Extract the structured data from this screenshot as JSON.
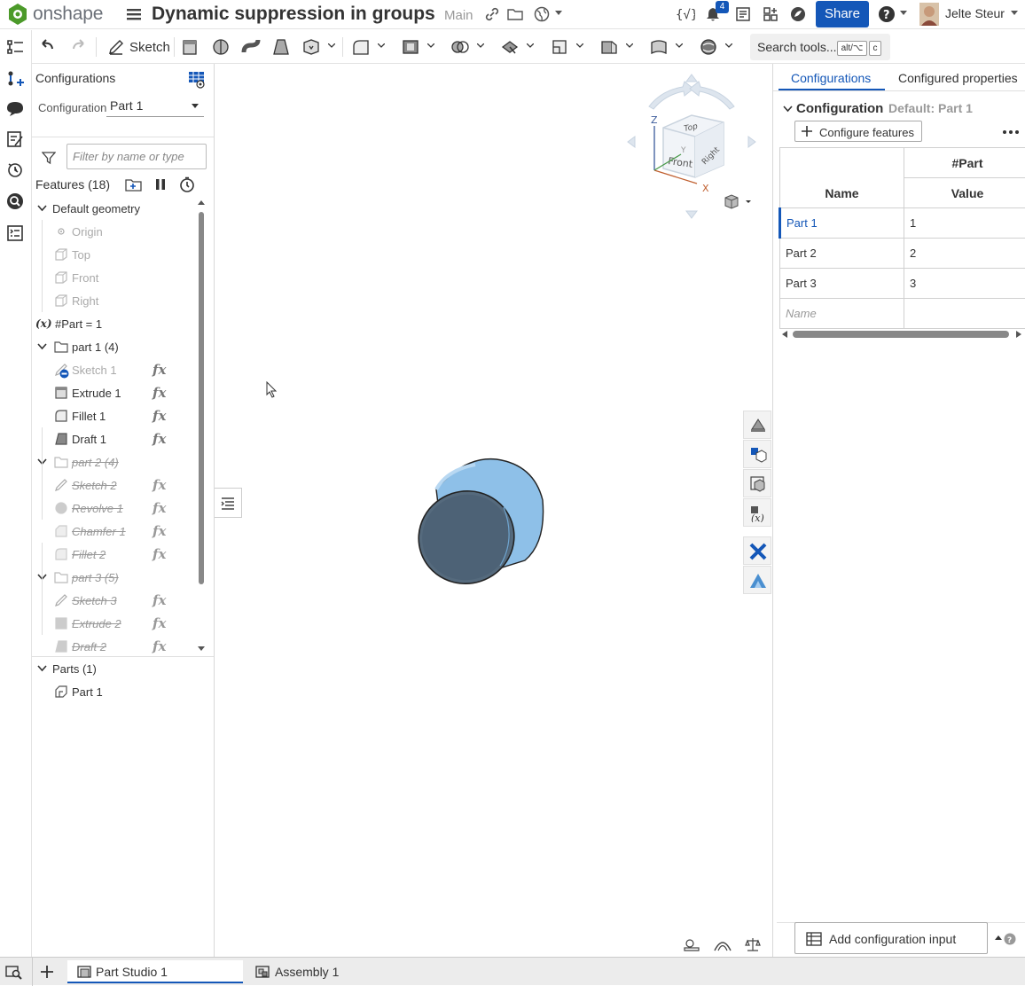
{
  "header": {
    "brand": "onshape",
    "document_title": "Dynamic suppression in groups",
    "branch": "Main",
    "notification_count": "4",
    "share_label": "Share",
    "user_name": "Jelte Steur",
    "brand_color": "#4c9a2a",
    "accent_color": "#1457b8"
  },
  "toolbar": {
    "sketch_label": "Sketch",
    "search_label": "Search tools...",
    "search_shortcut_1": "alt/⌥",
    "search_shortcut_2": "c"
  },
  "feature_panel": {
    "title": "Configurations",
    "configuration_label": "Configuration",
    "configuration_value": "Part 1",
    "filter_placeholder": "Filter by name or type",
    "features_header": "Features (18)",
    "tree": [
      {
        "label": "Default geometry",
        "kind": "group-open",
        "state": "normal"
      },
      {
        "label": "Origin",
        "kind": "origin",
        "state": "dim"
      },
      {
        "label": "Top",
        "kind": "plane",
        "state": "dim"
      },
      {
        "label": "Front",
        "kind": "plane",
        "state": "dim"
      },
      {
        "label": "Right",
        "kind": "plane",
        "state": "dim"
      },
      {
        "label": "#Part = 1",
        "kind": "variable",
        "state": "normal"
      },
      {
        "label": "part 1 (4)",
        "kind": "folder",
        "state": "normal"
      },
      {
        "label": "Sketch 1",
        "kind": "sketch",
        "state": "dim",
        "fx": true
      },
      {
        "label": "Extrude 1",
        "kind": "extrude",
        "state": "normal",
        "fx": true
      },
      {
        "label": "Fillet 1",
        "kind": "fillet",
        "state": "normal",
        "fx": true
      },
      {
        "label": "Draft 1",
        "kind": "draft",
        "state": "normal",
        "fx": true
      },
      {
        "label": "part 2 (4)",
        "kind": "folder",
        "state": "suppressed"
      },
      {
        "label": "Sketch 2",
        "kind": "sketch",
        "state": "suppressed",
        "fx": true
      },
      {
        "label": "Revolve 1",
        "kind": "revolve",
        "state": "suppressed",
        "fx": true
      },
      {
        "label": "Chamfer 1",
        "kind": "chamfer",
        "state": "suppressed",
        "fx": true
      },
      {
        "label": "Fillet 2",
        "kind": "fillet",
        "state": "suppressed",
        "fx": true
      },
      {
        "label": "part 3 (5)",
        "kind": "folder",
        "state": "suppressed"
      },
      {
        "label": "Sketch 3",
        "kind": "sketch",
        "state": "suppressed",
        "fx": true
      },
      {
        "label": "Extrude 2",
        "kind": "extrude",
        "state": "suppressed",
        "fx": true
      },
      {
        "label": "Draft 2",
        "kind": "draft",
        "state": "suppressed",
        "fx": true
      }
    ],
    "fx_glyph": "fx",
    "parts_header": "Parts (1)",
    "parts": [
      "Part 1"
    ]
  },
  "viewcube": {
    "face_top": "Top",
    "face_front": "Front",
    "face_right": "Right",
    "axis_x": "X",
    "axis_y": "Y",
    "axis_z": "Z"
  },
  "config_panel": {
    "tabs": [
      "Configurations",
      "Configured properties"
    ],
    "active_tab": "Configurations",
    "section_title": "Configuration",
    "default_label": "Default: Part 1",
    "configure_button": "Configure features",
    "table": {
      "group_header": "#Part",
      "name_header": "Name",
      "value_header": "Value",
      "rows": [
        {
          "name": "Part 1",
          "value": "1",
          "selected": true
        },
        {
          "name": "Part 2",
          "value": "2"
        },
        {
          "name": "Part 3",
          "value": "3"
        }
      ],
      "name_placeholder": "Name"
    },
    "add_input_label": "Add configuration input"
  },
  "bottom_tabs": [
    {
      "label": "Part Studio 1",
      "active": true
    },
    {
      "label": "Assembly 1",
      "active": false
    }
  ]
}
